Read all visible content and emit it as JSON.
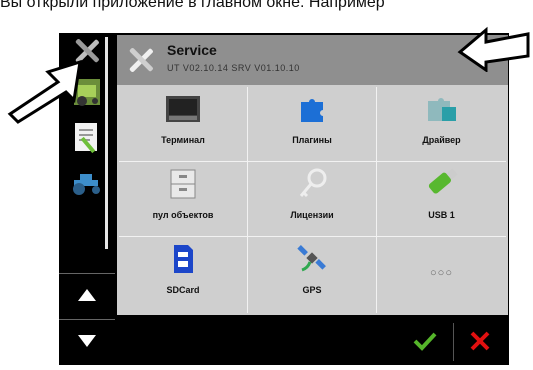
{
  "caption": "Вы открыли приложение в главном окне. Например",
  "header": {
    "title": "Service",
    "subtitle": "UT V02.10.14  SRV V01.10.10"
  },
  "tiles": [
    {
      "label": "Терминал",
      "icon": "terminal-icon"
    },
    {
      "label": "Плагины",
      "icon": "plugin-icon"
    },
    {
      "label": "Драйвер",
      "icon": "driver-icon"
    },
    {
      "label": "пул объектов",
      "icon": "object-pool-icon"
    },
    {
      "label": "Лицензии",
      "icon": "key-icon"
    },
    {
      "label": "USB 1",
      "icon": "usb-icon"
    },
    {
      "label": "SDCard",
      "icon": "sdcard-icon"
    },
    {
      "label": "GPS",
      "icon": "satellite-icon"
    },
    {
      "label": "",
      "icon": "more-icon"
    }
  ],
  "more_text": "○○○",
  "colors": {
    "header_bg": "#8f8f8f",
    "panel_bg": "#cfcfcf",
    "ok": "#55b52a",
    "cancel": "#e01010"
  }
}
